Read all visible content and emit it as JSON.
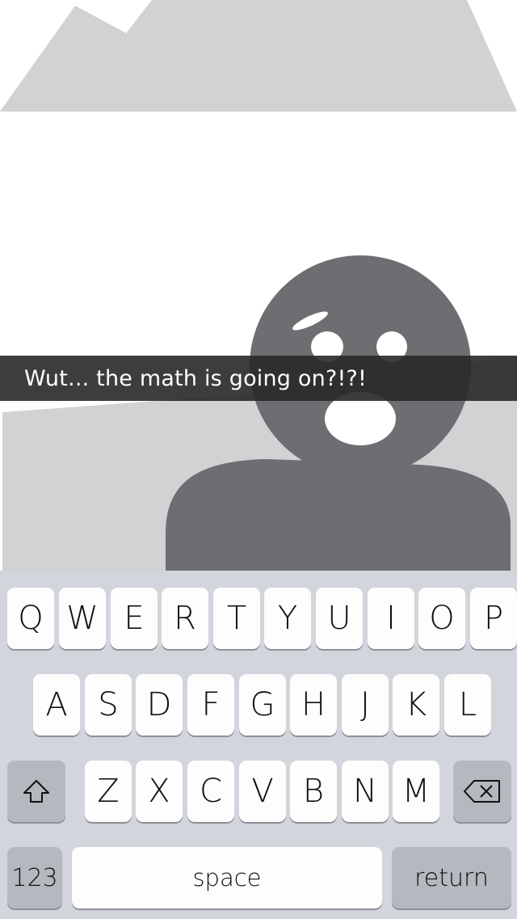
{
  "caption": {
    "text": "Wut... the math is going on?!?!"
  },
  "keyboard": {
    "row1": [
      "Q",
      "W",
      "E",
      "R",
      "T",
      "Y",
      "U",
      "I",
      "O",
      "P"
    ],
    "row2": [
      "A",
      "S",
      "D",
      "F",
      "G",
      "H",
      "J",
      "K",
      "L"
    ],
    "row3": [
      "Z",
      "X",
      "C",
      "V",
      "B",
      "N",
      "M"
    ],
    "numbers_label": "123",
    "space_label": "space",
    "return_label": "return",
    "shift_icon": "shift-icon",
    "delete_icon": "delete-icon"
  },
  "colors": {
    "keyboard_bg": "#d2d5db",
    "key_bg": "#fdfdfe",
    "modifier_key_bg": "#b4b8bf",
    "figure": "#6d6e71",
    "scenery": "#d1d2d4",
    "caption_bar": "#2b2b2b"
  }
}
